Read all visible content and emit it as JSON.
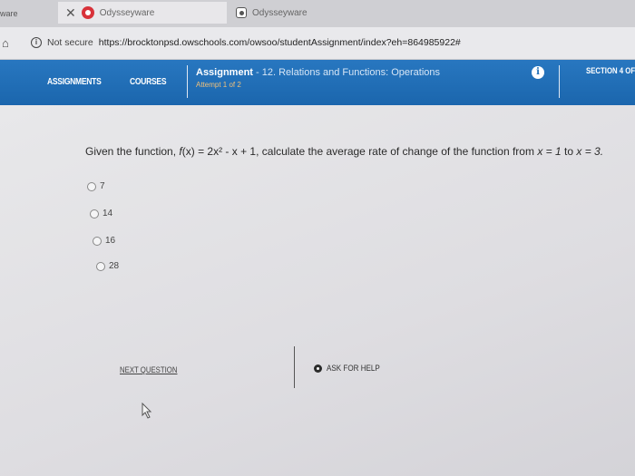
{
  "browser": {
    "tabs": [
      {
        "title": "ware"
      },
      {
        "title": "Odysseyware"
      },
      {
        "title": "Odysseyware"
      }
    ],
    "address": {
      "security_label": "Not secure",
      "url": "https://brocktonpsd.owschools.com/owsoo/studentAssignment/index?eh=864985922#"
    }
  },
  "nav": {
    "assignments": "ASSIGNMENTS",
    "courses": "COURSES",
    "assignment_label": "Assignment",
    "assignment_sub": "- 12. Relations and Functions: Operations",
    "attempt": "Attempt 1 of 2",
    "section": "SECTION 4 OF"
  },
  "question": {
    "prefix": "Given the function, ",
    "func_name": "f",
    "func_arg": "(x)",
    "func_def": " = 2x² - x + 1, calculate the average rate of change of the function from ",
    "x1": "x = 1",
    "to": " to ",
    "x2": "x = 3."
  },
  "options": [
    "7",
    "14",
    "16",
    "28"
  ],
  "footer": {
    "next_question": "NEXT QUESTION",
    "ask_for_help": "ASK FOR HELP"
  }
}
